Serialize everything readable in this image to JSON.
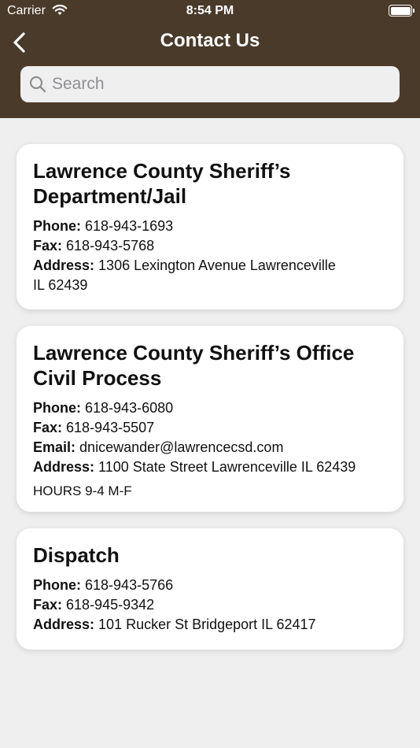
{
  "status": {
    "carrier": "Carrier",
    "time": "8:54 PM"
  },
  "nav": {
    "title": "Contact Us"
  },
  "search": {
    "placeholder": "Search",
    "value": ""
  },
  "labels": {
    "phone": "Phone:",
    "fax": "Fax:",
    "email": "Email:",
    "address": "Address:"
  },
  "contacts": [
    {
      "name": "Lawrence County Sheriff’s Department/Jail",
      "phone": "618-943-1693",
      "fax": "618-943-5768",
      "address": "1306 Lexington Avenue Lawrenceville IL  62439"
    },
    {
      "name": "Lawrence County Sheriff’s Office Civil Process",
      "phone": "618-943-6080",
      "fax": "618-943-5507",
      "email": "dnicewander@lawrencecsd.com",
      "address": "1100 State Street Lawrenceville IL  62439",
      "hours": "HOURS 9-4 M-F"
    },
    {
      "name": "Dispatch",
      "phone": "618-943-5766",
      "fax": "618-945-9342",
      "address": "101 Rucker St Bridgeport IL  62417"
    }
  ],
  "colors": {
    "header": "#4a3a2a",
    "background": "#efefef",
    "card": "#ffffff"
  }
}
